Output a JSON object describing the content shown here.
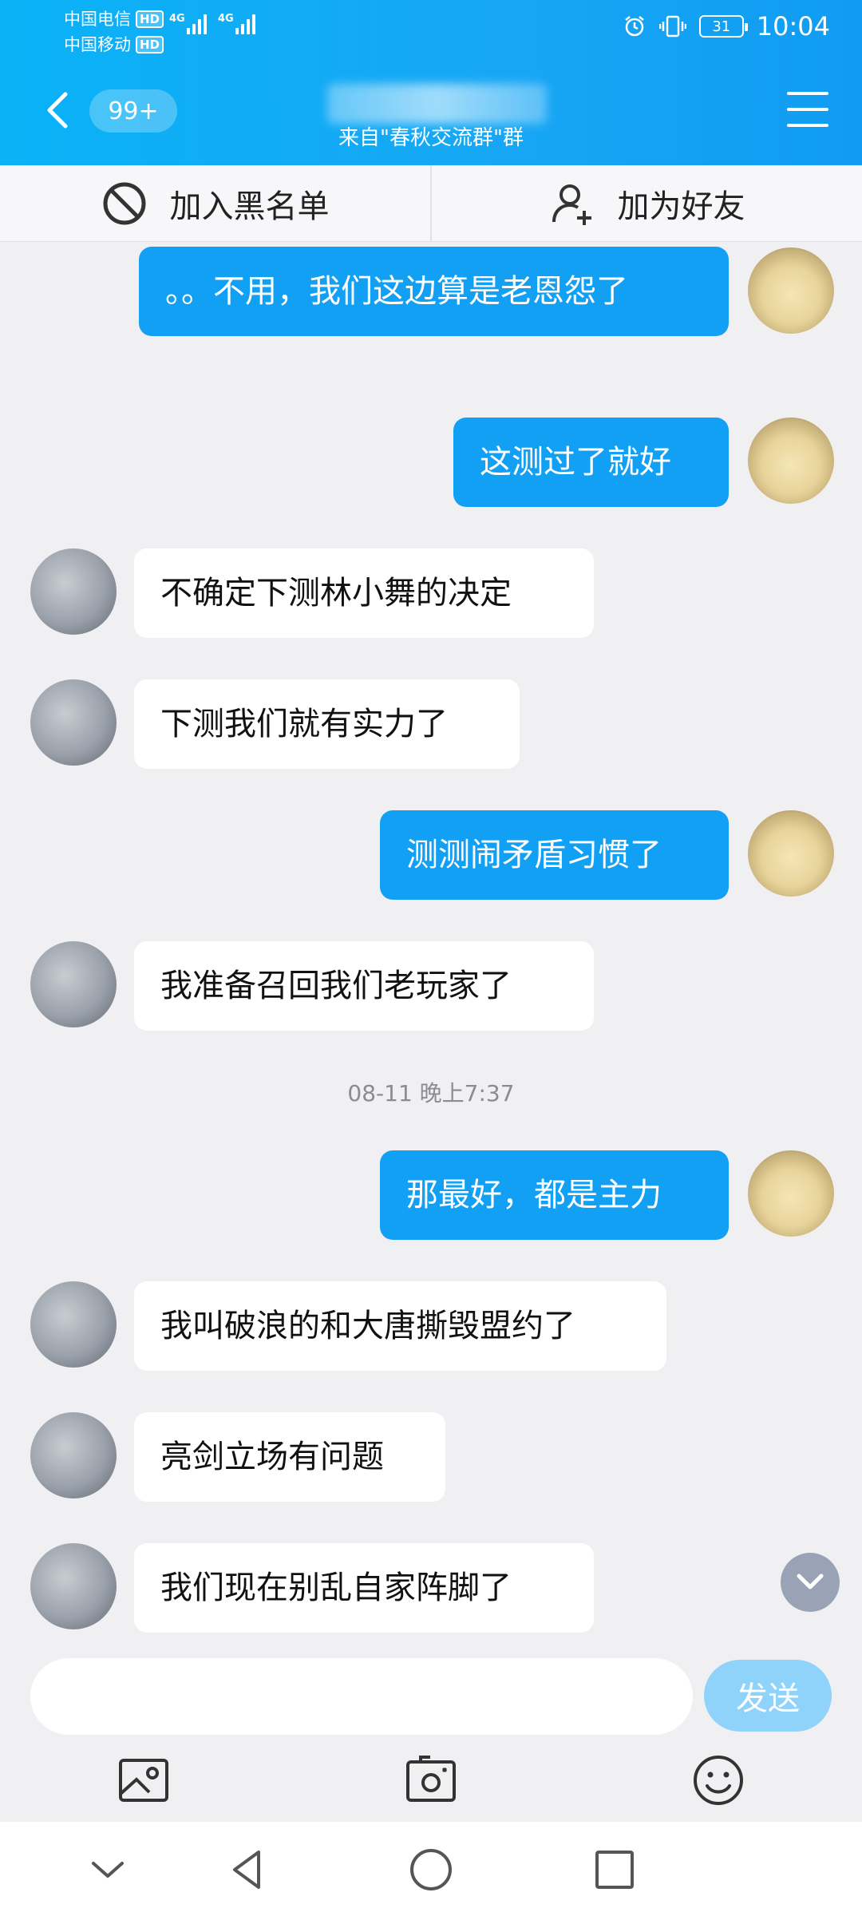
{
  "status": {
    "carrier1": "中国电信",
    "carrier2": "中国移动",
    "hd": "HD",
    "network1": "4G",
    "network2": "4G",
    "battery": "31",
    "time": "10:04"
  },
  "header": {
    "unread_badge": "99+",
    "subtitle": "来自\"春秋交流群\"群"
  },
  "actions": {
    "blacklist_label": "加入黑名单",
    "add_friend_label": "加为好友"
  },
  "messages": [
    {
      "side": "me",
      "text": "。。不用，我们这边算是老恩怨了"
    },
    {
      "side": "me",
      "text": "这测过了就好"
    },
    {
      "side": "other",
      "text": "不确定下测林小舞的决定"
    },
    {
      "side": "other",
      "text": "下测我们就有实力了"
    },
    {
      "side": "me",
      "text": "测测闹矛盾习惯了"
    },
    {
      "side": "other",
      "text": "我准备召回我们老玩家了"
    },
    {
      "side": "me",
      "text": "那最好，都是主力"
    },
    {
      "side": "other",
      "text": "我叫破浪的和大唐撕毁盟约了"
    },
    {
      "side": "other",
      "text": "亮剑立场有问题"
    },
    {
      "side": "other",
      "text": "我们现在别乱自家阵脚了"
    }
  ],
  "timestamp": "08-11 晚上7:37",
  "input": {
    "value": "",
    "send_label": "发送"
  },
  "colors": {
    "header_blue": "#0ab2f6",
    "my_bubble": "#12a0f5",
    "send_button": "#8fd3fb"
  }
}
